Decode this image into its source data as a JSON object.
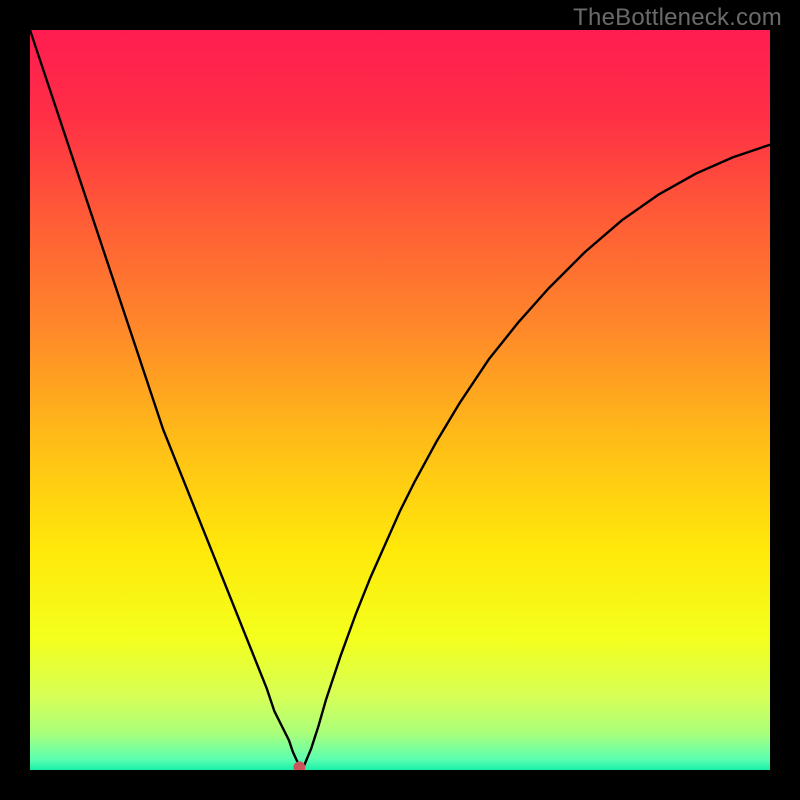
{
  "watermark": "TheBottleneck.com",
  "chart_data": {
    "type": "line",
    "title": "",
    "xlabel": "",
    "ylabel": "",
    "xlim": [
      0,
      100
    ],
    "ylim": [
      0,
      100
    ],
    "grad_stops": [
      {
        "offset": 0.0,
        "color": "#ff1c51"
      },
      {
        "offset": 0.12,
        "color": "#ff3045"
      },
      {
        "offset": 0.25,
        "color": "#ff5a37"
      },
      {
        "offset": 0.4,
        "color": "#ff872a"
      },
      {
        "offset": 0.55,
        "color": "#ffbb18"
      },
      {
        "offset": 0.7,
        "color": "#ffe80a"
      },
      {
        "offset": 0.82,
        "color": "#f4ff1c"
      },
      {
        "offset": 0.9,
        "color": "#d7ff55"
      },
      {
        "offset": 0.95,
        "color": "#aaff7a"
      },
      {
        "offset": 0.985,
        "color": "#5dffb0"
      },
      {
        "offset": 1.0,
        "color": "#19f0a8"
      }
    ],
    "series": [
      {
        "name": "bottleneck-curve",
        "stroke": "#000000",
        "stroke_width": 2.4,
        "x": [
          0,
          2,
          4,
          6,
          8,
          10,
          12,
          14,
          16,
          18,
          20,
          22,
          24,
          26,
          28,
          30,
          32,
          33,
          34,
          35,
          35.5,
          36,
          36.3,
          36.6,
          37,
          38,
          39,
          40,
          42,
          44,
          46,
          48,
          50,
          52,
          55,
          58,
          62,
          66,
          70,
          75,
          80,
          85,
          90,
          95,
          100
        ],
        "y": [
          100,
          94,
          88,
          82,
          76,
          70,
          64,
          58,
          52,
          46,
          41,
          36,
          31,
          26,
          21,
          16,
          11,
          8,
          6,
          4,
          2.5,
          1.4,
          0.8,
          0.4,
          0.5,
          2.9,
          6,
          9.5,
          15.5,
          21,
          26,
          30.5,
          35,
          39,
          44.5,
          49.5,
          55.5,
          60.5,
          65,
          70,
          74.3,
          77.8,
          80.6,
          82.8,
          84.5
        ]
      }
    ],
    "marker": {
      "x": 36.4,
      "y": 0.35,
      "r": 6,
      "fill": "#c9555a"
    },
    "legend": []
  }
}
